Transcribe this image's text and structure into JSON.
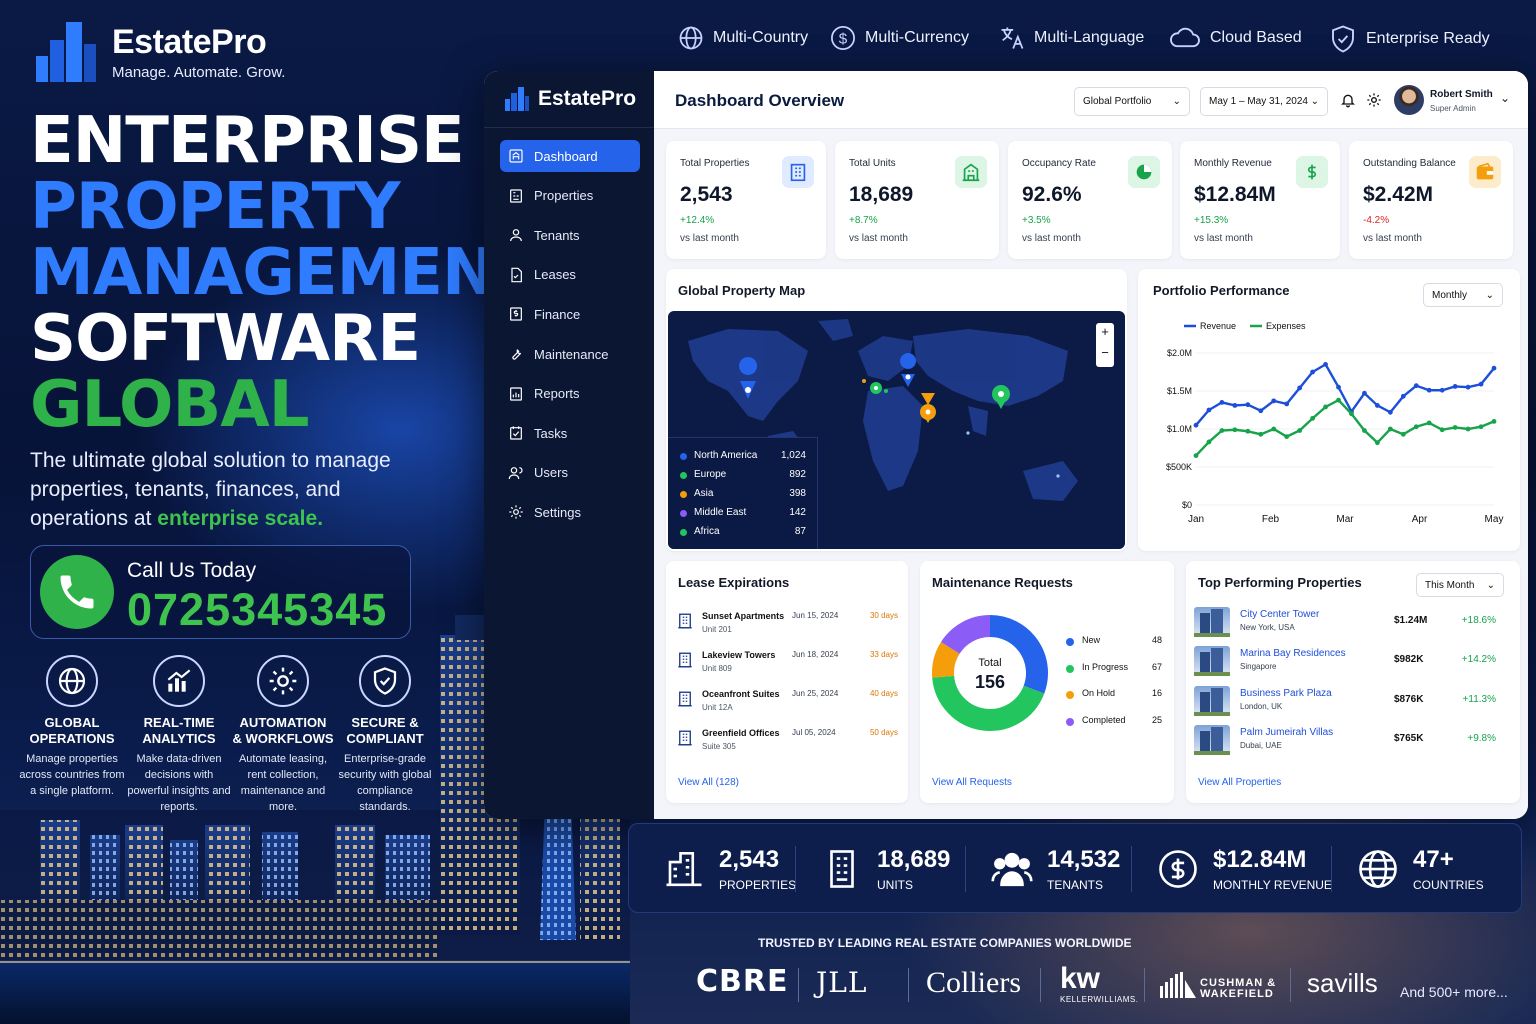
{
  "brand": {
    "name": "EstatePro",
    "tagline": "Manage. Automate. Grow."
  },
  "hero": {
    "line1": "ENTERPRISE",
    "line2": "PROPERTY",
    "line3": "MANAGEMENT",
    "line4": "SOFTWARE",
    "line5": "GLOBAL"
  },
  "description": {
    "text": "The ultimate global solution to manage properties, tenants, finances, and operations at ",
    "highlight": "enterprise scale."
  },
  "call": {
    "label": "Call Us Today",
    "number": "0725345345"
  },
  "features": [
    {
      "icon": "globe-icon",
      "title": "GLOBAL\nOPERATIONS",
      "desc": "Manage properties across countries from a single platform."
    },
    {
      "icon": "analytics-icon",
      "title": "REAL-TIME\nANALYTICS",
      "desc": "Make data-driven decisions with powerful insights and reports."
    },
    {
      "icon": "gear-icon",
      "title": "AUTOMATION\n& WORKFLOWS",
      "desc": "Automate leasing, rent collection, maintenance and more."
    },
    {
      "icon": "shield-icon",
      "title": "SECURE &\nCOMPLIANT",
      "desc": "Enterprise-grade security with global compliance standards."
    }
  ],
  "top_features": [
    "Multi-Country",
    "Multi-Currency",
    "Multi-Language",
    "Cloud Based",
    "Enterprise Ready"
  ],
  "dashboard": {
    "brand": "EstatePro",
    "title": "Dashboard Overview",
    "portfolio_select": "Global Portfolio",
    "date_select": "May 1 – May 31, 2024",
    "user": {
      "name": "Robert Smith",
      "role": "Super Admin"
    },
    "nav": [
      "Dashboard",
      "Properties",
      "Tenants",
      "Leases",
      "Finance",
      "Maintenance",
      "Reports",
      "Tasks",
      "Users",
      "Settings"
    ],
    "kpis": [
      {
        "label": "Total Properties",
        "value": "2,543",
        "change": "+12.4%",
        "sub": "vs last month",
        "color": "#2563eb",
        "bg": "#e0ebff",
        "trend": "up",
        "icon": "building-icon"
      },
      {
        "label": "Total Units",
        "value": "18,689",
        "change": "+8.7%",
        "sub": "vs last month",
        "color": "#16a34a",
        "bg": "#dcf5e4",
        "trend": "up",
        "icon": "units-icon"
      },
      {
        "label": "Occupancy Rate",
        "value": "92.6%",
        "change": "+3.5%",
        "sub": "vs last month",
        "color": "#16a34a",
        "bg": "#dcf5e4",
        "trend": "up",
        "icon": "pie-icon"
      },
      {
        "label": "Monthly Revenue",
        "value": "$12.84M",
        "change": "+15.3%",
        "sub": "vs last month",
        "color": "#16a34a",
        "bg": "#dcf5e4",
        "trend": "up",
        "icon": "dollar-icon"
      },
      {
        "label": "Outstanding Balance",
        "value": "$2.42M",
        "change": "-4.2%",
        "sub": "vs last month",
        "color": "#f59e0b",
        "bg": "#fdeccc",
        "trend": "down",
        "icon": "wallet-icon"
      }
    ],
    "map": {
      "title": "Global Property Map",
      "zoom_in": "+",
      "zoom_out": "−",
      "regions": [
        {
          "name": "North America",
          "value": "1,024",
          "color": "#2563eb"
        },
        {
          "name": "Europe",
          "value": "892",
          "color": "#22c55e"
        },
        {
          "name": "Asia",
          "value": "398",
          "color": "#f59e0b"
        },
        {
          "name": "Middle East",
          "value": "142",
          "color": "#8b5cf6"
        },
        {
          "name": "Africa",
          "value": "87",
          "color": "#22c55e"
        }
      ]
    },
    "performance": {
      "title": "Portfolio Performance",
      "select": "Monthly"
    },
    "leases": {
      "title": "Lease Expirations",
      "link": "View All (128)",
      "rows": [
        {
          "name": "Sunset Apartments",
          "unit": "Unit 201",
          "date": "Jun 15, 2024",
          "days": "30 days"
        },
        {
          "name": "Lakeview Towers",
          "unit": "Unit 809",
          "date": "Jun 18, 2024",
          "days": "33 days"
        },
        {
          "name": "Oceanfront Suites",
          "unit": "Unit 12A",
          "date": "Jun 25, 2024",
          "days": "40 days"
        },
        {
          "name": "Greenfield Offices",
          "unit": "Suite 305",
          "date": "Jul 05, 2024",
          "days": "50 days"
        }
      ]
    },
    "maintenance": {
      "title": "Maintenance Requests",
      "total_label": "Total",
      "total": "156",
      "link": "View All Requests",
      "items": [
        {
          "label": "New",
          "value": 48,
          "color": "#2563eb"
        },
        {
          "label": "In Progress",
          "value": 67,
          "color": "#22c55e"
        },
        {
          "label": "On Hold",
          "value": 16,
          "color": "#f59e0b"
        },
        {
          "label": "Completed",
          "value": 25,
          "color": "#8b5cf6"
        }
      ]
    },
    "top_properties": {
      "title": "Top Performing Properties",
      "select": "This Month",
      "link": "View All Properties",
      "rows": [
        {
          "name": "City Center Tower",
          "loc": "New York, USA",
          "value": "$1.24M",
          "change": "+18.6%"
        },
        {
          "name": "Marina Bay Residences",
          "loc": "Singapore",
          "value": "$982K",
          "change": "+14.2%"
        },
        {
          "name": "Business Park Plaza",
          "loc": "London, UK",
          "value": "$876K",
          "change": "+11.3%"
        },
        {
          "name": "Palm Jumeirah Villas",
          "loc": "Dubai, UAE",
          "value": "$765K",
          "change": "+9.8%"
        }
      ]
    }
  },
  "chart_data": {
    "type": "line",
    "title": "Portfolio Performance",
    "x_ticks": [
      "Jan",
      "Feb",
      "Mar",
      "Apr",
      "May"
    ],
    "y_ticks": [
      "$0",
      "$500K",
      "$1.0M",
      "$1.5M",
      "$2.0M"
    ],
    "ylim": [
      0,
      2000000
    ],
    "legend": "top-left",
    "series": [
      {
        "name": "Revenue",
        "color": "#1d4ed8",
        "values": [
          1050000,
          1250000,
          1350000,
          1310000,
          1320000,
          1240000,
          1370000,
          1330000,
          1540000,
          1750000,
          1850000,
          1550000,
          1230000,
          1470000,
          1310000,
          1220000,
          1430000,
          1570000,
          1510000,
          1510000,
          1560000,
          1550000,
          1590000,
          1800000
        ]
      },
      {
        "name": "Expenses",
        "color": "#16a34a",
        "values": [
          650000,
          830000,
          980000,
          990000,
          970000,
          930000,
          1000000,
          900000,
          980000,
          1140000,
          1290000,
          1380000,
          1200000,
          980000,
          820000,
          1000000,
          930000,
          1030000,
          1080000,
          990000,
          1020000,
          1000000,
          1030000,
          1100000
        ]
      }
    ]
  },
  "stats": [
    {
      "icon": "building-icon",
      "value": "2,543",
      "label": "PROPERTIES"
    },
    {
      "icon": "units-icon",
      "value": "18,689",
      "label": "UNITS"
    },
    {
      "icon": "tenants-icon",
      "value": "14,532",
      "label": "TENANTS"
    },
    {
      "icon": "dollar-icon",
      "value": "$12.84M",
      "label": "MONTHLY REVENUE"
    },
    {
      "icon": "globe-icon",
      "value": "47+",
      "label": "COUNTRIES"
    }
  ],
  "trusted": {
    "title": "TRUSTED BY LEADING REAL ESTATE COMPANIES WORLDWIDE",
    "logos": [
      "CBRE",
      "JLL",
      "Colliers",
      "kw",
      "KELLERWILLIAMS.",
      "CUSHMAN &",
      "WAKEFIELD",
      "savills"
    ],
    "more": "And 500+ more..."
  }
}
